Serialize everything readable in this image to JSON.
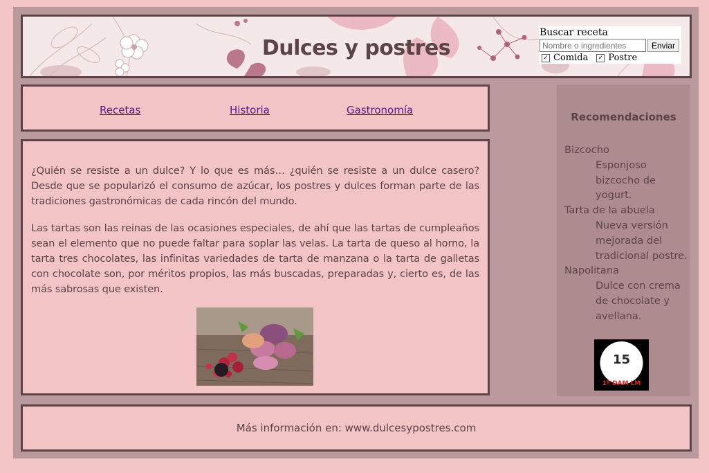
{
  "header": {
    "title": "Dulces y postres",
    "search": {
      "label": "Buscar receta",
      "placeholder": "Nombre o ingredientes",
      "submit_label": "Enviar",
      "checkbox_comida": {
        "label": "Comida",
        "checked": true
      },
      "checkbox_postre": {
        "label": "Postre",
        "checked": true
      }
    }
  },
  "nav": {
    "links": [
      {
        "label": "Recetas"
      },
      {
        "label": "Historia"
      },
      {
        "label": "Gastronomía"
      }
    ]
  },
  "main": {
    "paragraphs": [
      "¿Quién se resiste a un dulce? Y lo que es más… ¿quién se resiste a un dulce casero? Desde que se popularizó el consumo de azúcar, los postres y dulces forman parte de las tradiciones gastronómicas de cada rincón del mundo.",
      "Las tartas son las reinas de las ocasiones especiales, de ahí que las tartas de cumpleaños sean el elemento que no puede faltar para soplar las velas. La tarta de queso al horno, la tarta tres chocolates, las infinitas variedades de tarta de manzana o la tarta de galletas con chocolate son, por méritos propios, las más buscadas, preparadas y, cierto es, de las más sabrosas que existen."
    ]
  },
  "sidebar": {
    "title": "Recomendaciones",
    "items": [
      {
        "name": "Bizcocho",
        "description": "Esponjoso bizcocho de yogurt."
      },
      {
        "name": "Tarta de la abuela",
        "description": "Nueva versión mejorada del tradicional postre."
      },
      {
        "name": "Napolitana",
        "description": "Dulce con crema de chocolate y avellana."
      }
    ],
    "logo_text": "1º DAM LM"
  },
  "footer": {
    "text": "Más información en: www.dulcesypostres.com"
  },
  "colors": {
    "page_bg": "#f2c4c6",
    "frame_bg": "#bb9a9e",
    "sidebar_bg": "#ae8b8f",
    "border": "#5d4247",
    "text": "#5b4448",
    "link": "#551a8b"
  }
}
